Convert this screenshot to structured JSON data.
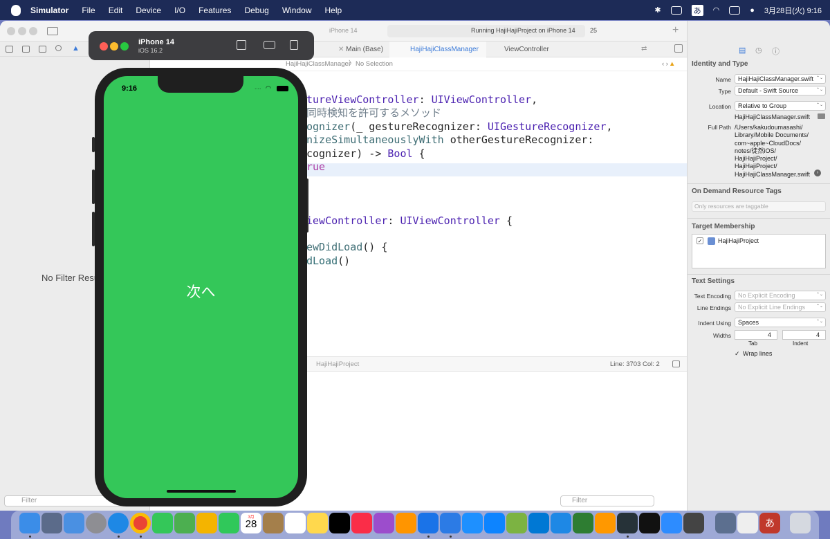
{
  "menubar": {
    "app": "Simulator",
    "items": [
      "File",
      "Edit",
      "Device",
      "I/O",
      "Features",
      "Debug",
      "Window",
      "Help"
    ],
    "input_method": "あ",
    "date_time": "3月28日(火) 9:16"
  },
  "xcode": {
    "scheme": "HajiHajiProject",
    "destination": "iPhone 14",
    "run_status": "Running HajiHajiProject on iPhone 14",
    "warning_count": "25",
    "tabs": [
      "Main (Base)",
      "HajiHajiClassManager",
      "ViewController"
    ],
    "jump_bar": [
      "HajiHajiClassManager",
      "No Selection"
    ],
    "code_lines": [
      {
        "segments": [
          {
            "t": "tureViewController",
            "c": "ty"
          },
          {
            "t": ": ",
            "c": ""
          },
          {
            "t": "UIViewController",
            "c": "ty"
          },
          {
            "t": ",",
            "c": ""
          }
        ]
      },
      {
        "segments": [
          {
            "t": "同時検知を許可するメソッド",
            "c": "cm"
          }
        ]
      },
      {
        "segments": [
          {
            "t": "ognizer",
            "c": "fn"
          },
          {
            "t": "(_ gestureRecognizer: ",
            "c": ""
          },
          {
            "t": "UIGestureRecognizer",
            "c": "ty"
          },
          {
            "t": ",",
            "c": ""
          }
        ]
      },
      {
        "segments": [
          {
            "t": "nizeSimultaneouslyWith",
            "c": "fn"
          },
          {
            "t": " otherGestureRecognizer:",
            "c": ""
          }
        ]
      },
      {
        "segments": [
          {
            "t": "cognizer) -> ",
            "c": ""
          },
          {
            "t": "Bool",
            "c": "ty"
          },
          {
            "t": " {",
            "c": ""
          }
        ]
      },
      {
        "segments": [
          {
            "t": "rue",
            "c": "kw"
          }
        ]
      },
      {
        "segments": [
          {
            "t": "",
            "c": ""
          }
        ]
      },
      {
        "segments": [
          {
            "t": "",
            "c": ""
          }
        ]
      },
      {
        "segments": [
          {
            "t": "",
            "c": ""
          }
        ]
      },
      {
        "segments": [
          {
            "t": "iewController",
            "c": "ty"
          },
          {
            "t": ": ",
            "c": ""
          },
          {
            "t": "UIViewController",
            "c": "ty"
          },
          {
            "t": " {",
            "c": ""
          }
        ]
      },
      {
        "segments": [
          {
            "t": "",
            "c": ""
          }
        ]
      },
      {
        "segments": [
          {
            "t": "ewDidLoad",
            "c": "fn"
          },
          {
            "t": "() {",
            "c": ""
          }
        ]
      },
      {
        "segments": [
          {
            "t": "dLoad",
            "c": "mt"
          },
          {
            "t": "()",
            "c": ""
          }
        ]
      }
    ],
    "status_target": "HajiHajiProject",
    "line_col": "Line: 3703  Col: 2",
    "navigator_empty": "No Filter Results",
    "navigator_filter_placeholder": "Filter",
    "editor_filter_placeholder": "Filter"
  },
  "inspector": {
    "identity_header": "Identity and Type",
    "name_label": "Name",
    "name_value": "HajiHajiClassManager.swift",
    "type_label": "Type",
    "type_value": "Default - Swift Source",
    "location_label": "Location",
    "location_value": "Relative to Group",
    "location_file": "HajiHajiClassManager.swift",
    "fullpath_label": "Full Path",
    "fullpath_lines": [
      "/Users/kakudoumasashi/",
      "Library/Mobile Documents/",
      "com~apple~CloudDocs/",
      "notes/徒然iOS/",
      "HajiHajiProject/",
      "HajiHajiProject/",
      "HajiHajiClassManager.swift"
    ],
    "odr_header": "On Demand Resource Tags",
    "odr_placeholder": "Only resources are taggable",
    "target_header": "Target Membership",
    "target_name": "HajiHajiProject",
    "text_header": "Text Settings",
    "encoding_label": "Text Encoding",
    "encoding_value": "No Explicit Encoding",
    "endings_label": "Line Endings",
    "endings_value": "No Explicit Line Endings",
    "indent_label": "Indent Using",
    "indent_value": "Spaces",
    "widths_label": "Widths",
    "tab_width": "4",
    "indent_width": "4",
    "tab_caption": "Tab",
    "indent_caption": "Indent",
    "wrap_label": "Wrap lines"
  },
  "simulator": {
    "device": "iPhone 14",
    "os": "iOS 16.2",
    "time": "9:16",
    "button_label": "次へ",
    "screen_color": "#34c759"
  },
  "dock": {
    "calendar_month": "3月",
    "calendar_day": "28",
    "notes_char": "あ"
  }
}
